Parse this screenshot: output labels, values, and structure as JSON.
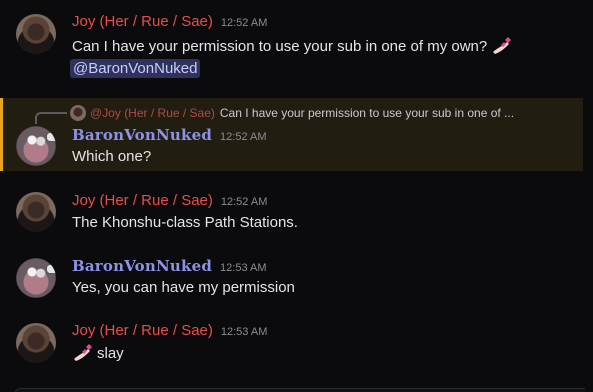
{
  "messages": [
    {
      "author": "Joy (Her / Rue / Sae)",
      "time": "12:52 AM",
      "text": "Can I have your permission to use your sub in one of my own?",
      "mention": "@BaronVonNuked"
    },
    {
      "reply_to": {
        "author": "@Joy (Her / Rue / Sae)",
        "text": "Can I have your permission to use your sub in one of ..."
      },
      "author": "BaronVonNuked",
      "time": "12:52 AM",
      "text": "Which one?"
    },
    {
      "author": "Joy (Her / Rue / Sae)",
      "time": "12:52 AM",
      "text": "The Khonshu-class Path Stations."
    },
    {
      "author": "BaronVonNuked",
      "time": "12:53 AM",
      "text": "Yes, you can have my permission"
    },
    {
      "author": "Joy (Her / Rue / Sae)",
      "time": "12:53 AM",
      "text": "slay"
    }
  ],
  "colors": {
    "background": "#0b0b0d",
    "joy_name": "#ea4c4c",
    "baron_name": "#8b92e8",
    "mention_bg": "#2f335c",
    "reply_highlight": "#e6a51b"
  },
  "icons": {
    "nail_polish": "nail-polish-icon"
  }
}
